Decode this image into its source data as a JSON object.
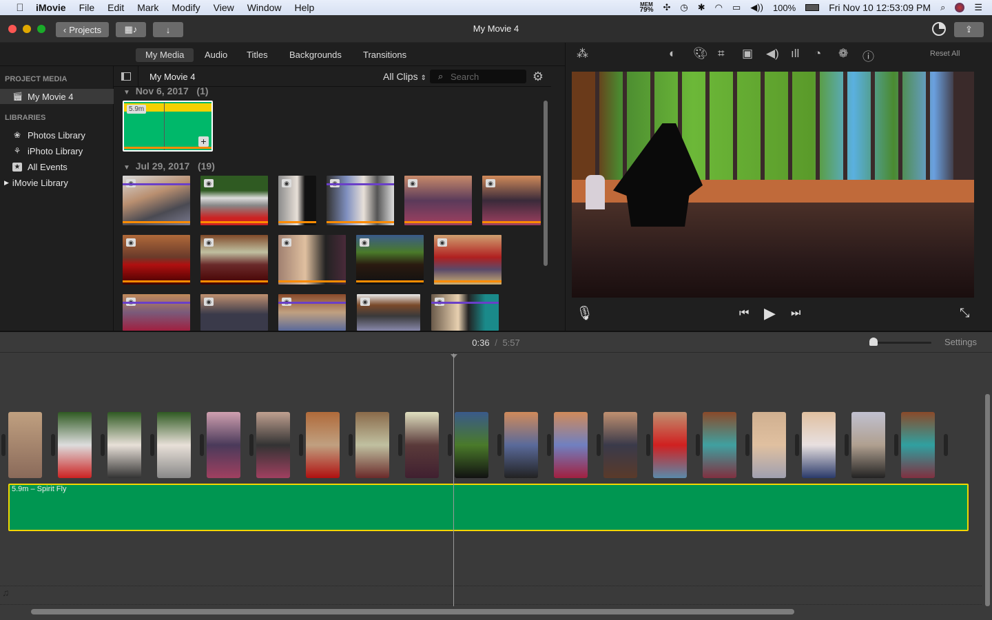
{
  "menubar": {
    "app": "iMovie",
    "items": [
      "File",
      "Edit",
      "Mark",
      "Modify",
      "View",
      "Window",
      "Help"
    ],
    "status": {
      "mem_label": "MEM",
      "mem_value": "79%",
      "battery": "100%",
      "datetime": "Fri Nov 10  12:53:09 PM"
    }
  },
  "titlebar": {
    "title": "My Movie 4",
    "projects_button": "Projects"
  },
  "browser": {
    "tabs": [
      "My Media",
      "Audio",
      "Titles",
      "Backgrounds",
      "Transitions"
    ],
    "active_tab": "My Media",
    "current_item": "My Movie 4",
    "filter": "All Clips",
    "search_placeholder": "Search"
  },
  "sidebar": {
    "project_media_header": "PROJECT MEDIA",
    "project_item": "My Movie 4",
    "libraries_header": "LIBRARIES",
    "libraries": [
      {
        "label": "Photos Library",
        "icon": "photos-icon"
      },
      {
        "label": "iPhoto Library",
        "icon": "palm-tree-icon"
      },
      {
        "label": "All Events",
        "icon": "star-icon"
      },
      {
        "label": "iMovie Library",
        "icon": "disclosure-triangle-icon"
      }
    ]
  },
  "media_groups": [
    {
      "date": "Nov 6, 2017",
      "count": "(1)",
      "clips": [
        {
          "duration": "5.9m",
          "type": "audio"
        }
      ]
    },
    {
      "date": "Jul 29, 2017",
      "count": "(19)",
      "clips_count": 19
    }
  ],
  "viewer": {
    "reset_all": "Reset All",
    "tools": [
      "magic-wand",
      "color-balance",
      "color-correction",
      "crop",
      "stabilization",
      "volume",
      "noise-reduction",
      "speed",
      "clip-filter",
      "info"
    ]
  },
  "timeline": {
    "current_time": "0:36",
    "separator": "/",
    "total_time": "5:57",
    "settings": "Settings",
    "audio_clip_label": "5.9m – Spirit Fly",
    "zoom_level": 0.0
  },
  "colors": {
    "audio_clip": "#009651",
    "selection": "#f3d600",
    "favorite_bar": "#ff8c00",
    "used_bar": "#6a3fc8"
  }
}
